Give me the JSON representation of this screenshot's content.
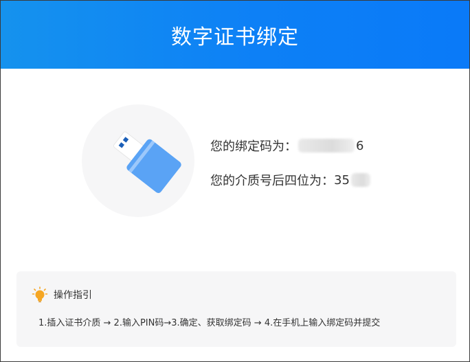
{
  "dialog": {
    "title": "数字证书绑定"
  },
  "info": {
    "bind_code_label": "您的绑定码为：",
    "bind_code_visible_prefix": "",
    "bind_code_visible_suffix": "6",
    "media_label": "您的介质号后四位为：",
    "media_visible_prefix": "35"
  },
  "guide": {
    "title": "操作指引",
    "steps": "1.插入证书介质 → 2.输入PIN码→3.确定、获取绑定码 → 4.在手机上输入绑定码并提交"
  },
  "icons": {
    "usb": "usb-key-icon",
    "bulb": "lightbulb-icon"
  },
  "colors": {
    "header": "#0d80f6",
    "usb_body": "#5aa3f5",
    "bulb": "#f5a623"
  }
}
